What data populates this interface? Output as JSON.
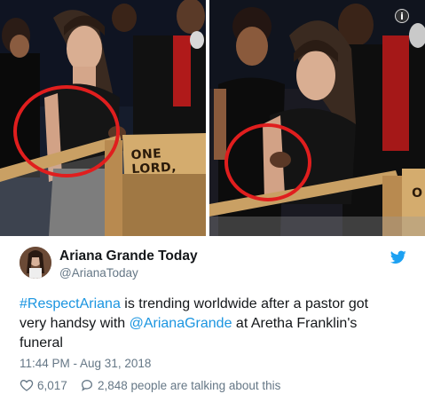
{
  "media": {
    "sign_text_left": "ONE LORD,",
    "sign_text_right": "O",
    "info_icon": "info-icon"
  },
  "author": {
    "name": "Ariana Grande Today",
    "handle": "@ArianaToday",
    "brand_icon": "twitter-bird-icon",
    "brand_color": "#1da1f2"
  },
  "tweet": {
    "hashtag": "#RespectAriana",
    "text_part1": " is trending worldwide after a pastor got very handsy with ",
    "mention": "@ArianaGrande",
    "text_part2": " at Aretha Franklin's funeral",
    "link_color": "#1b95e0"
  },
  "timestamp": "11:44 PM - Aug 31, 2018",
  "actions": {
    "like_icon": "heart-icon",
    "likes": "6,017",
    "reply_icon": "reply-bubble-icon",
    "talking": "2,848 people are talking about this"
  }
}
